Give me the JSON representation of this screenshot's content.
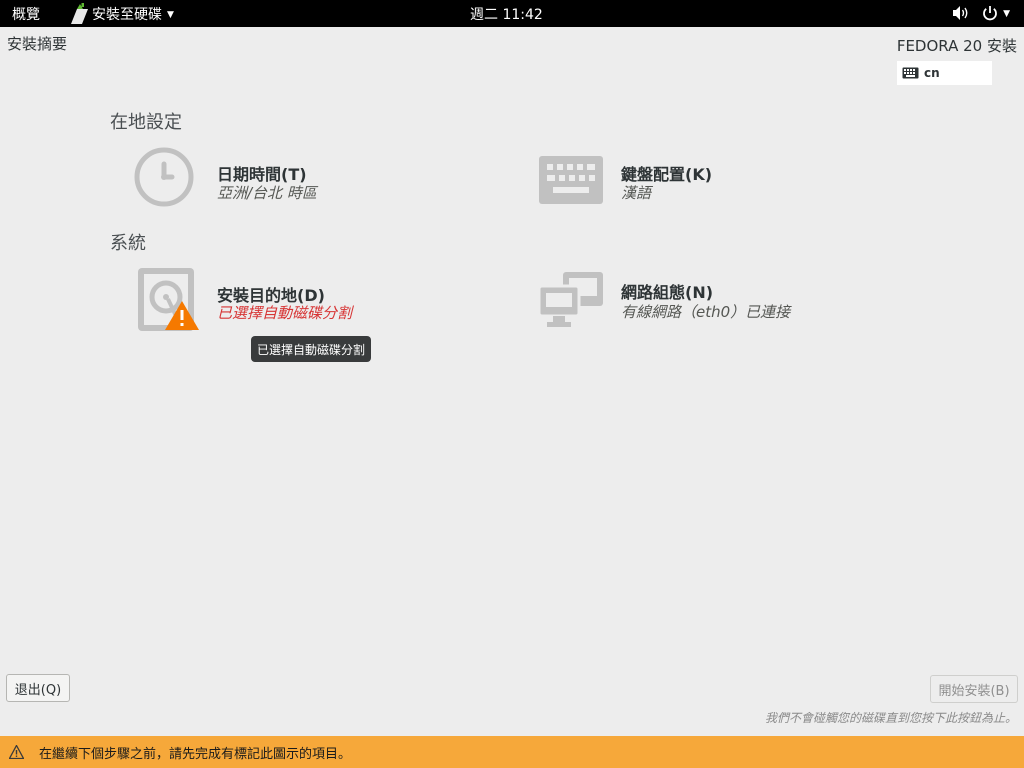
{
  "topbar": {
    "activities": "概覽",
    "app_name": "安裝至硬碟",
    "clock": "週二 11:42"
  },
  "header": {
    "summary_title": "安裝摘要",
    "product_title": "FEDORA 20 安裝",
    "keyboard_layout": "cn"
  },
  "categories": {
    "localization": "在地設定",
    "system": "系統"
  },
  "spokes": {
    "datetime": {
      "title": "日期時間(T)",
      "status": "亞洲/台北 時區",
      "icon": "clock-icon"
    },
    "keyboard": {
      "title": "鍵盤配置(K)",
      "status": "漢語",
      "icon": "keyboard-icon"
    },
    "storage": {
      "title": "安裝目的地(D)",
      "status": "已選擇自動磁碟分割",
      "icon": "harddisk-icon"
    },
    "network": {
      "title": "網路組態(N)",
      "status": "有線網路（eth0）已連接",
      "icon": "network-icon"
    }
  },
  "tooltip": "已選擇自動磁碟分割",
  "footer": {
    "quit_button": "退出(Q)",
    "begin_button": "開始安裝(B)",
    "disk_note": "我們不會碰觸您的磁碟直到您按下此按鈕為止。"
  },
  "warning_bar": {
    "text": "在繼續下個步驟之前，請先完成有標記此圖示的項目。"
  },
  "colors": {
    "warning_bar": "#f6a83a",
    "warning_text": "#d73535",
    "icon_gray": "#c1c1c1",
    "topbar": "#000000",
    "background": "#ededed"
  }
}
